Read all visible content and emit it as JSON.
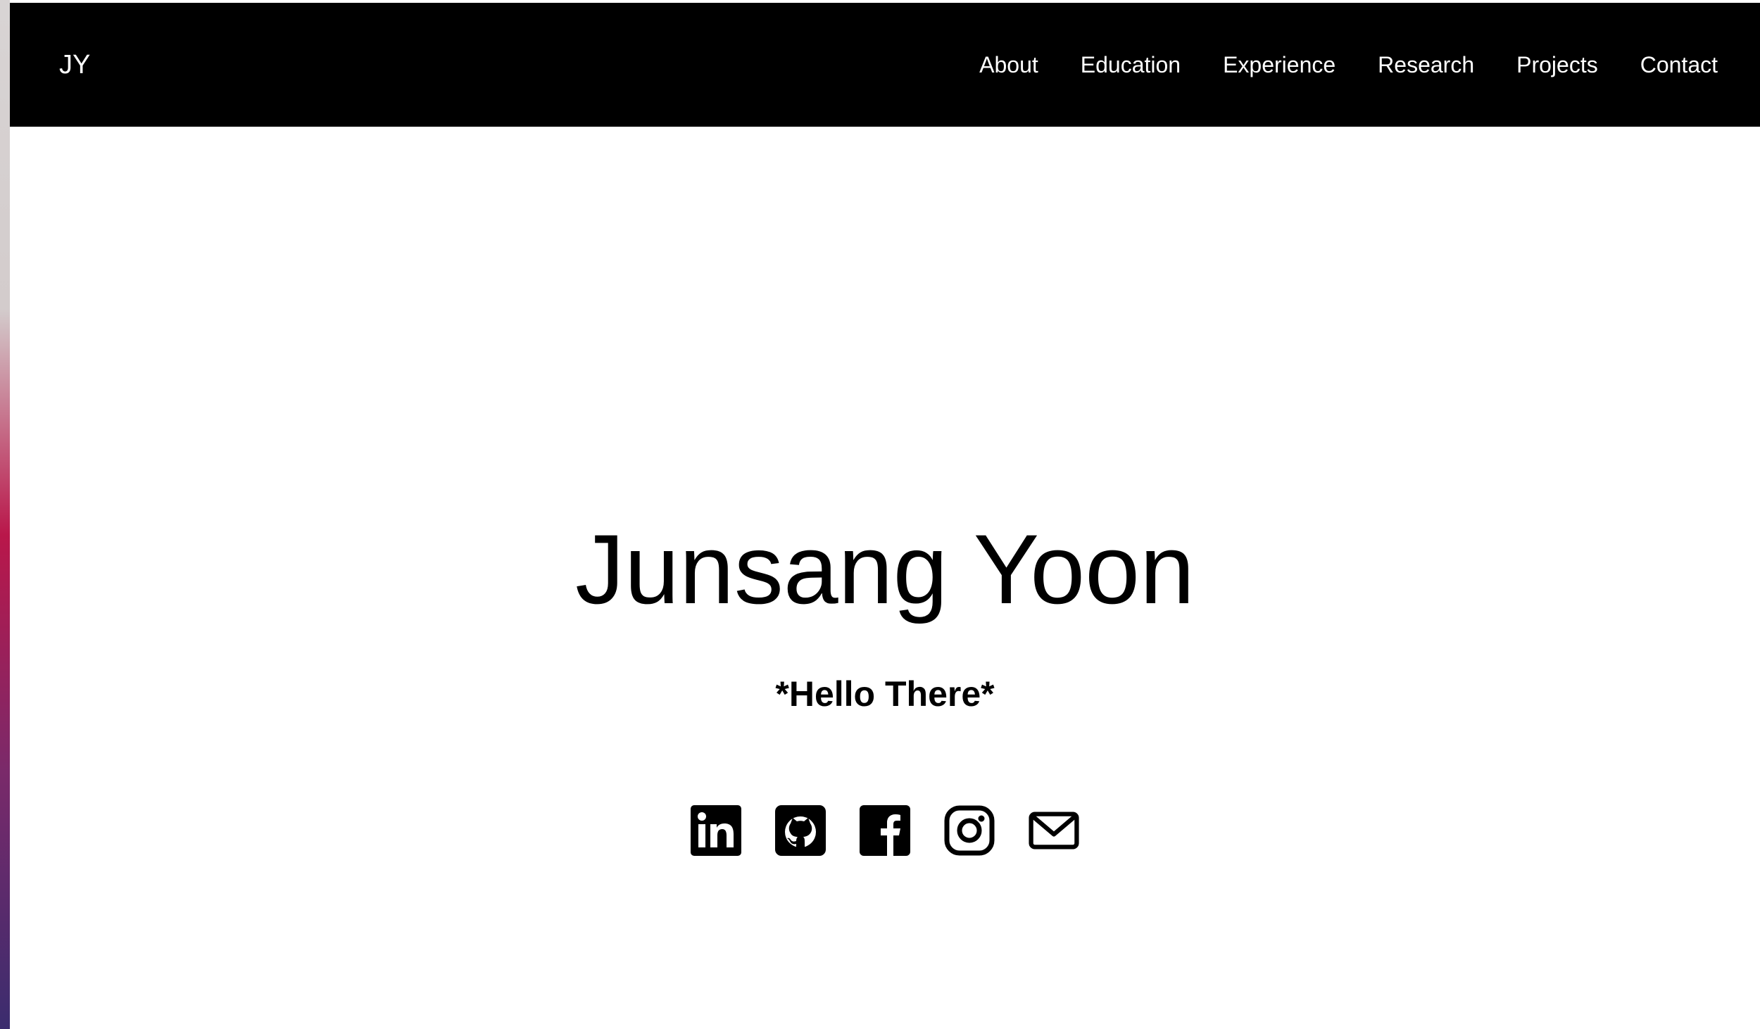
{
  "navbar": {
    "brand": "JY",
    "links": [
      {
        "label": "About"
      },
      {
        "label": "Education"
      },
      {
        "label": "Experience"
      },
      {
        "label": "Research"
      },
      {
        "label": "Projects"
      },
      {
        "label": "Contact"
      }
    ]
  },
  "hero": {
    "name": "Junsang Yoon",
    "tagline": "*Hello There*"
  },
  "social": [
    {
      "icon": "linkedin-icon"
    },
    {
      "icon": "github-icon"
    },
    {
      "icon": "facebook-icon"
    },
    {
      "icon": "instagram-icon"
    },
    {
      "icon": "email-icon"
    }
  ],
  "colors": {
    "navbar_background": "#000000",
    "navbar_text": "#ffffff",
    "page_background": "#ffffff",
    "text": "#000000"
  }
}
